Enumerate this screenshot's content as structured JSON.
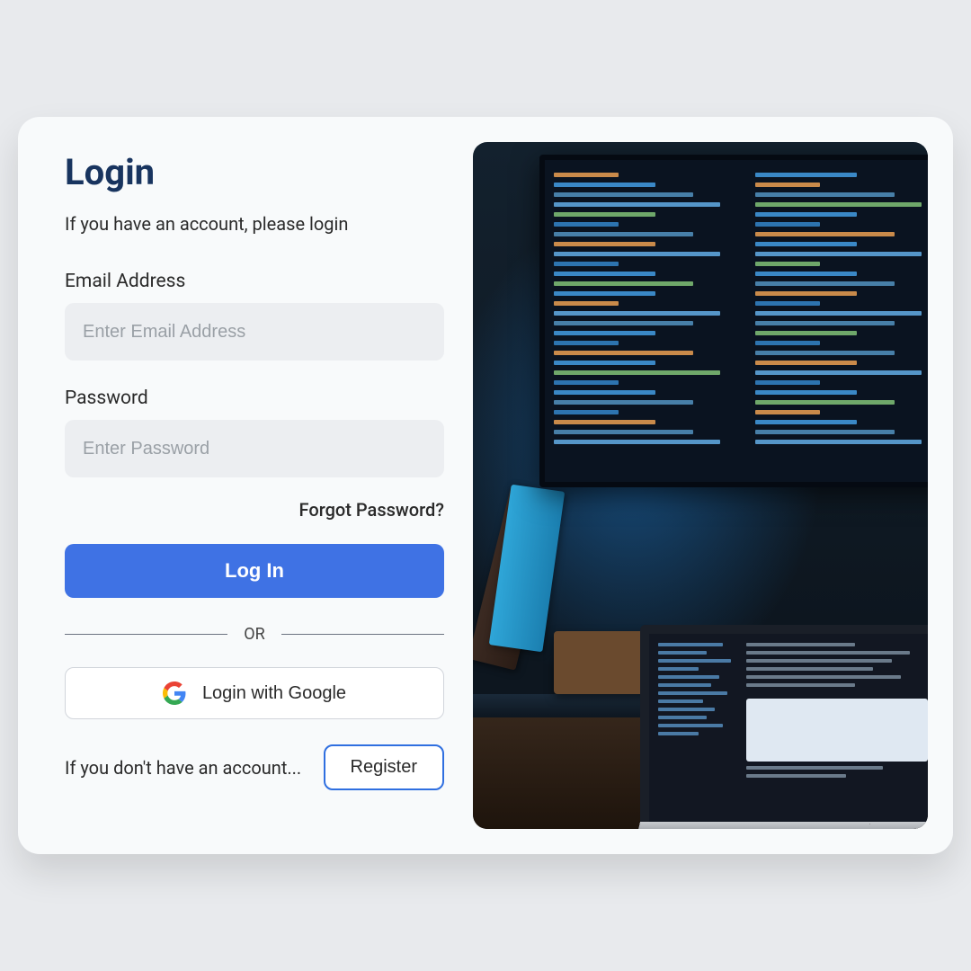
{
  "title": "Login",
  "subtitle": "If you have an account, please login",
  "email": {
    "label": "Email Address",
    "placeholder": "Enter Email Address"
  },
  "password": {
    "label": "Password",
    "placeholder": "Enter Password"
  },
  "forgot": "Forgot Password?",
  "login_button": "Log In",
  "divider": "OR",
  "google_button": "Login with Google",
  "register_prompt": "If you don't have an account...",
  "register_button": "Register"
}
